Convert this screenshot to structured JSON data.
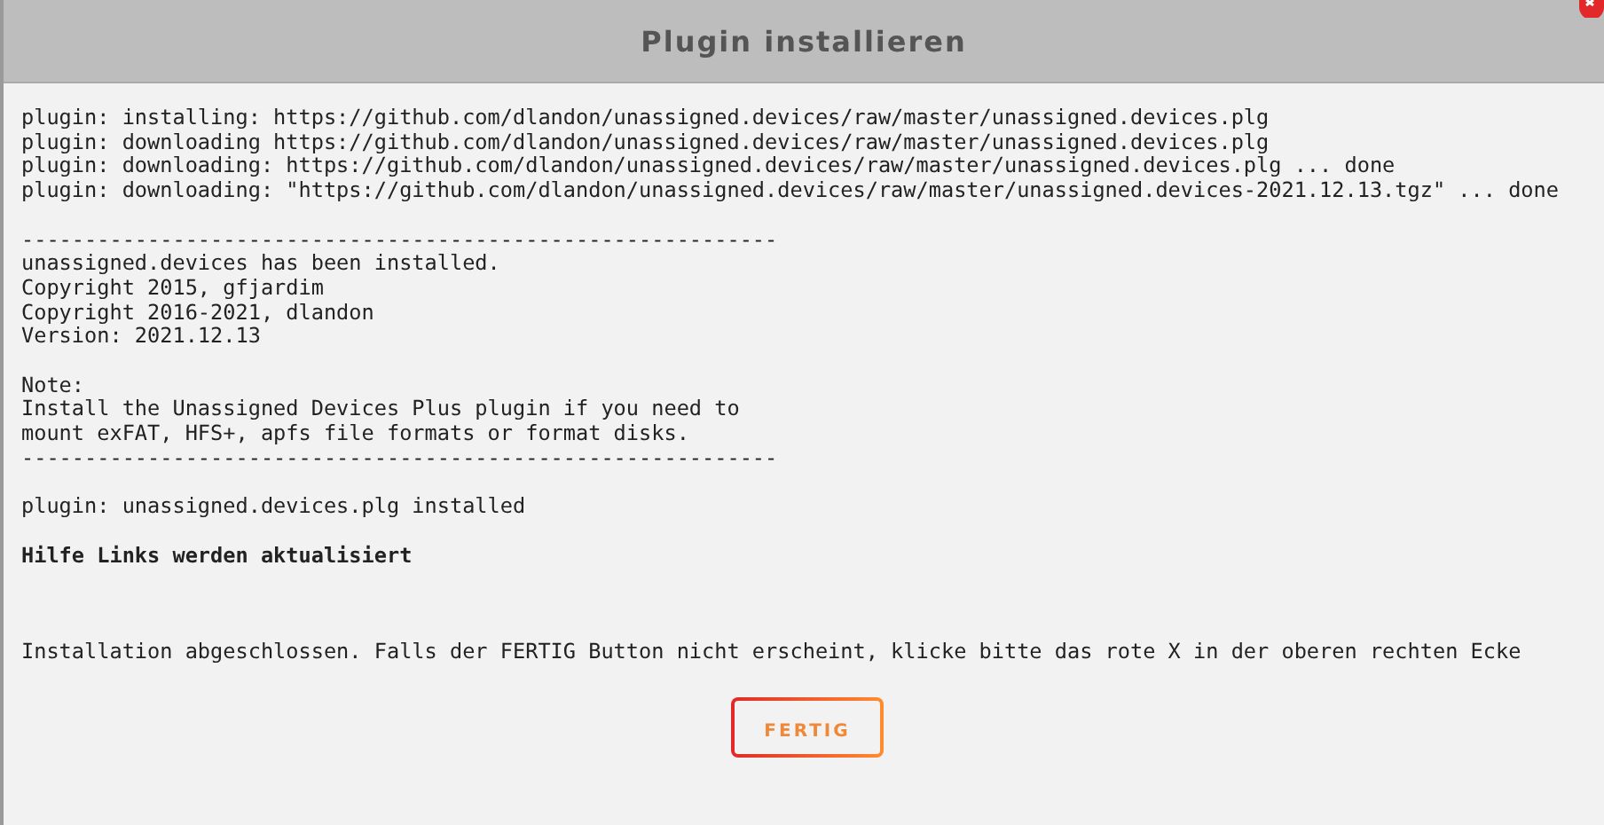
{
  "window": {
    "title": "Plugin installieren"
  },
  "log": [
    {
      "kind": "line",
      "text": "plugin: installing: https://github.com/dlandon/unassigned.devices/raw/master/unassigned.devices.plg"
    },
    {
      "kind": "line",
      "text": "plugin: downloading https://github.com/dlandon/unassigned.devices/raw/master/unassigned.devices.plg"
    },
    {
      "kind": "line",
      "text": "plugin: downloading: https://github.com/dlandon/unassigned.devices/raw/master/unassigned.devices.plg ... done"
    },
    {
      "kind": "line",
      "text": "plugin: downloading: \"https://github.com/dlandon/unassigned.devices/raw/master/unassigned.devices-2021.12.13.tgz\" ... done"
    },
    {
      "kind": "space"
    },
    {
      "kind": "line",
      "text": "------------------------------------------------------------"
    },
    {
      "kind": "line",
      "text": "unassigned.devices has been installed."
    },
    {
      "kind": "line",
      "text": "Copyright 2015, gfjardim"
    },
    {
      "kind": "line",
      "text": "Copyright 2016-2021, dlandon"
    },
    {
      "kind": "line",
      "text": "Version: 2021.12.13"
    },
    {
      "kind": "space"
    },
    {
      "kind": "line",
      "text": "Note:"
    },
    {
      "kind": "line",
      "text": "Install the Unassigned Devices Plus plugin if you need to"
    },
    {
      "kind": "line",
      "text": "mount exFAT, HFS+, apfs file formats or format disks."
    },
    {
      "kind": "line",
      "text": "------------------------------------------------------------"
    },
    {
      "kind": "space"
    },
    {
      "kind": "line",
      "text": "plugin: unassigned.devices.plg installed"
    },
    {
      "kind": "space"
    },
    {
      "kind": "bold",
      "text": "Hilfe Links werden aktualisiert"
    },
    {
      "kind": "space"
    },
    {
      "kind": "space"
    },
    {
      "kind": "space"
    },
    {
      "kind": "line",
      "text": "Installation abgeschlossen. Falls der FERTIG Button nicht erscheint, klicke bitte das rote X in der oberen rechten Ecke"
    }
  ],
  "button": {
    "label": "FERTIG"
  }
}
